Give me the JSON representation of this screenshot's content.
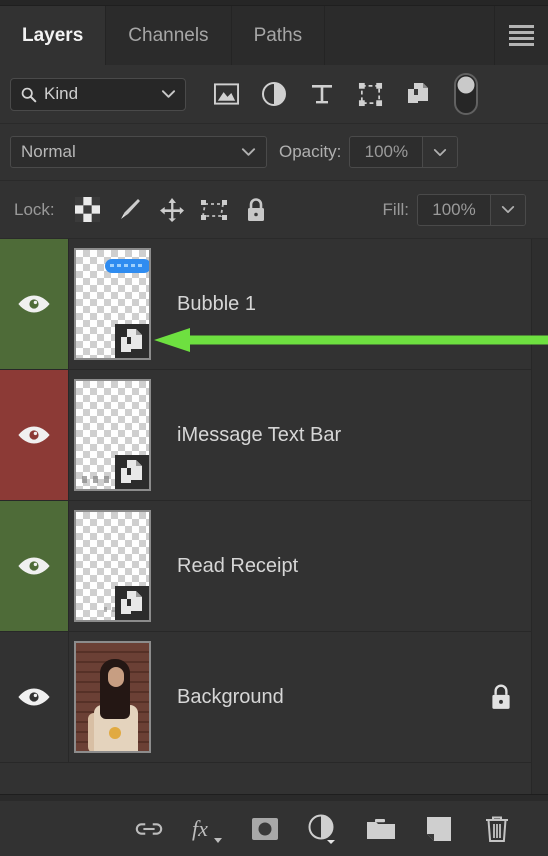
{
  "panel": {
    "tabs": [
      {
        "label": "Layers",
        "active": true
      },
      {
        "label": "Channels",
        "active": false
      },
      {
        "label": "Paths",
        "active": false
      }
    ],
    "menu_icon": "hamburger-menu-icon"
  },
  "filter": {
    "kind_label": "Kind",
    "search_icon": "search-icon",
    "chevron_icon": "chevron-down-icon",
    "type_filters": [
      {
        "name": "filter-pixel-layers-icon"
      },
      {
        "name": "filter-adjustment-layers-icon"
      },
      {
        "name": "filter-type-layers-icon"
      },
      {
        "name": "filter-shape-layers-icon"
      },
      {
        "name": "filter-smart-object-layers-icon"
      }
    ],
    "toggle_icon": "filter-enable-toggle"
  },
  "blend": {
    "mode": "Normal",
    "opacity_label": "Opacity:",
    "opacity_value": "100%"
  },
  "lock": {
    "label": "Lock:",
    "icons": [
      {
        "name": "lock-transparent-pixels-icon"
      },
      {
        "name": "lock-image-pixels-icon"
      },
      {
        "name": "lock-position-icon"
      },
      {
        "name": "lock-artboard-nesting-icon"
      },
      {
        "name": "lock-all-icon"
      }
    ],
    "fill_label": "Fill:",
    "fill_value": "100%"
  },
  "layers": [
    {
      "name": "Bubble 1",
      "visible": true,
      "color_label": "#4e6b38",
      "thumb_type": "transparent-bubble",
      "smart_object": true,
      "locked": false
    },
    {
      "name": "iMessage Text Bar",
      "visible": true,
      "color_label": "#8c3a36",
      "thumb_type": "transparent-textbar",
      "smart_object": true,
      "locked": false
    },
    {
      "name": "Read Receipt",
      "visible": true,
      "color_label": "#4e6b38",
      "thumb_type": "transparent-receipt",
      "smart_object": true,
      "locked": false
    },
    {
      "name": "Background",
      "visible": true,
      "color_label": "none",
      "thumb_type": "photo",
      "smart_object": false,
      "locked": true
    }
  ],
  "bottom_bar": [
    {
      "name": "link-layers-icon"
    },
    {
      "name": "layer-style-fx-icon"
    },
    {
      "name": "add-layer-mask-icon"
    },
    {
      "name": "new-adjustment-layer-icon"
    },
    {
      "name": "new-group-icon"
    },
    {
      "name": "new-layer-icon"
    },
    {
      "name": "delete-layer-icon"
    }
  ],
  "annotation": {
    "arrow_color": "#6ee040",
    "target": "Bubble 1 layer thumbnail"
  }
}
